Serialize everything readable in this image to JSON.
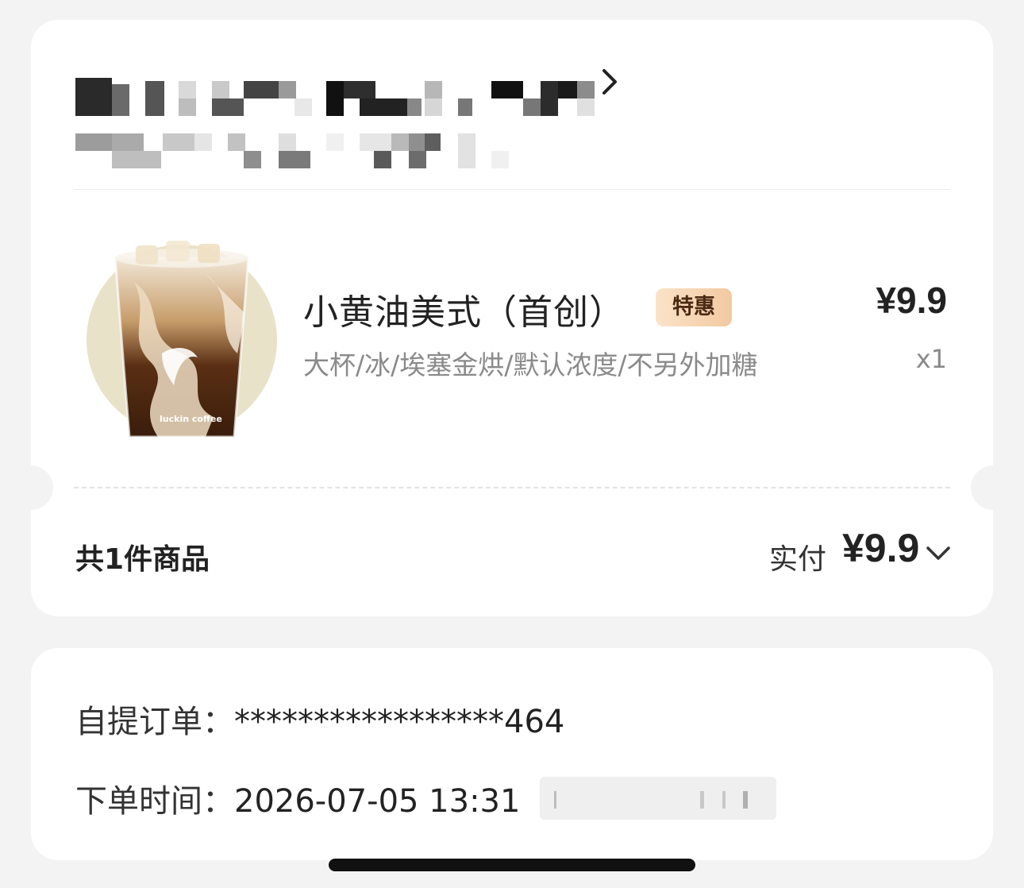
{
  "order": {
    "product": {
      "name": "小黄油美式（首创）",
      "badge": "特惠",
      "price": "¥9.9",
      "spec": "大杯/冰/埃塞金烘/默认浓度/不另外加糖",
      "quantity": "x1",
      "image_brand_text": "luckin coffee"
    },
    "summary": {
      "count_label": "共1件商品",
      "paid_label": "实付",
      "paid_amount": "¥9.9"
    }
  },
  "info": {
    "pickup_label": "自提订单：",
    "pickup_value": "*****************464",
    "time_label": "下单时间：",
    "time_value": "2026-07-05 13:31"
  },
  "colors": {
    "background": "#f3f3f3",
    "card": "#ffffff",
    "badge_gradient_start": "#fbe3c8",
    "badge_gradient_end": "#f2c9a1",
    "secondary_text": "#8a8a8a"
  },
  "icons": {
    "store_arrow": "chevron-right-icon",
    "expand": "chevron-down-icon"
  }
}
